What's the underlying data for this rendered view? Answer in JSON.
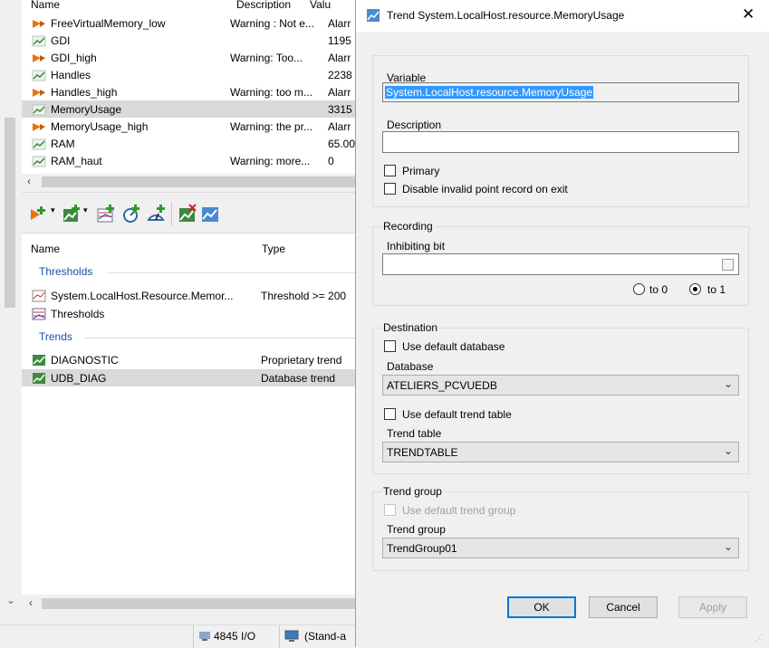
{
  "upper_list": {
    "headers": {
      "name": "Name",
      "description": "Description",
      "value": "Valu"
    },
    "rows": [
      {
        "name": "FreeVirtualMemory_low",
        "desc": "Warning : Not e...",
        "value": "Alarr",
        "icon": "alarm-icon"
      },
      {
        "name": "GDI",
        "desc": "",
        "value": "1195",
        "icon": "trend-line-icon"
      },
      {
        "name": "GDI_high",
        "desc": "Warning: Too...",
        "value": "Alarr",
        "icon": "alarm-icon"
      },
      {
        "name": "Handles",
        "desc": "",
        "value": "2238",
        "icon": "trend-line-icon"
      },
      {
        "name": "Handles_high",
        "desc": "Warning: too m...",
        "value": "Alarr",
        "icon": "alarm-icon"
      },
      {
        "name": "MemoryUsage",
        "desc": "",
        "value": "3315",
        "icon": "trend-line-icon",
        "selected": true
      },
      {
        "name": "MemoryUsage_high",
        "desc": "Warning: the pr...",
        "value": "Alarr",
        "icon": "alarm-icon"
      },
      {
        "name": "RAM",
        "desc": "",
        "value": "65.00",
        "icon": "trend-line-icon"
      },
      {
        "name": "RAM_haut",
        "desc": "Warning: more...",
        "value": "0",
        "icon": "trend-line-icon"
      }
    ]
  },
  "lower_list": {
    "headers": {
      "name": "Name",
      "type": "Type"
    },
    "groups": [
      {
        "label": "Thresholds",
        "items": [
          {
            "name": "System.LocalHost.Resource.Memor...",
            "type": "Threshold >= 200"
          },
          {
            "name": "Thresholds",
            "type": ""
          }
        ]
      },
      {
        "label": "Trends",
        "items": [
          {
            "name": "DIAGNOSTIC",
            "type": "Proprietary trend"
          },
          {
            "name": "UDB_DIAG",
            "type": "Database trend",
            "selected": true
          }
        ]
      }
    ]
  },
  "status": {
    "io": "4845 I/O",
    "mode": "(Stand-a"
  },
  "dialog": {
    "title": "Trend System.LocalHost.resource.MemoryUsage",
    "close": "✕",
    "variable_label": "Variable",
    "variable_value": "System.LocalHost.resource.MemoryUsage",
    "description_label": "Description",
    "description_value": "",
    "primary_label": "Primary",
    "disable_label": "Disable invalid point record on exit",
    "recording_label": "Recording",
    "inhibiting_label": "Inhibiting bit",
    "inhibiting_value": "",
    "to0_label": "to 0",
    "to1_label": "to 1",
    "destination_label": "Destination",
    "use_default_db_label": "Use default database",
    "database_label": "Database",
    "database_value": "ATELIERS_PCVUEDB",
    "use_default_table_label": "Use default trend table",
    "trend_table_label": "Trend table",
    "trend_table_value": "TRENDTABLE",
    "trend_group_box_label": "Trend group",
    "use_default_group_label": "Use default trend group",
    "trend_group_label": "Trend group",
    "trend_group_value": "TrendGroup01",
    "ok": "OK",
    "cancel": "Cancel",
    "apply": "Apply"
  },
  "colors": {
    "group_header": "#1a4fa6",
    "selection": "#3399ff",
    "alarm_icon": "#e8730c"
  }
}
